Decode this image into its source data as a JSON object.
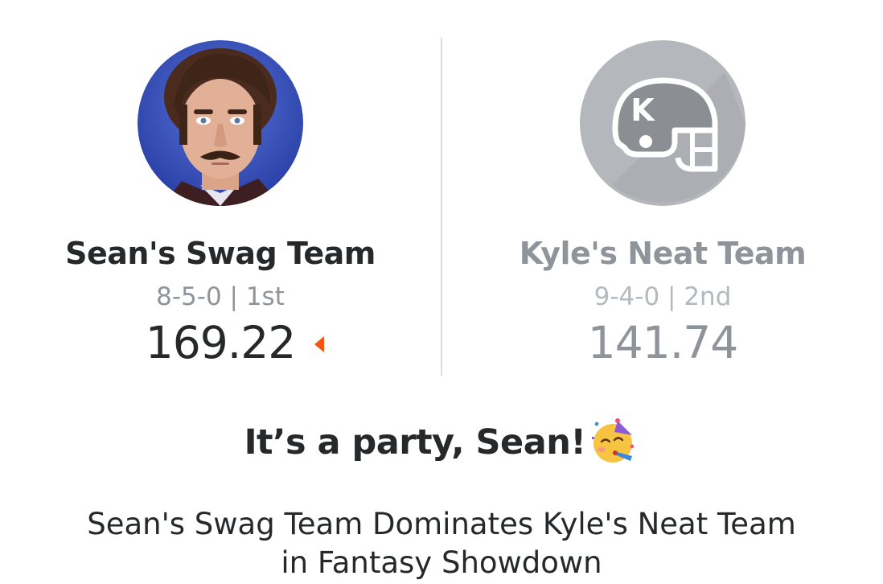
{
  "matchup": {
    "home": {
      "team_name": "Sean's Swag Team",
      "record": "8-5-0 | 1st",
      "score": "169.22",
      "is_winner": true,
      "avatar_icon": "manager-photo-avatar"
    },
    "away": {
      "team_name": "Kyle's Neat Team",
      "record": "9-4-0 | 2nd",
      "score": "141.74",
      "is_winner": false,
      "avatar_icon": "football-helmet-icon",
      "helmet_letter": "K"
    }
  },
  "result": {
    "headline": "It’s a party, Sean!",
    "headline_emoji": "partying-face-icon",
    "summary_line1": "Sean's Swag Team Dominates Kyle's Neat Team",
    "summary_line2": "in Fantasy Showdown"
  },
  "colors": {
    "winner_arrow": "#ff520d",
    "text_dark": "#26282a",
    "text_muted": "#8f949a",
    "helmet_bg": "#b4b7bb"
  }
}
